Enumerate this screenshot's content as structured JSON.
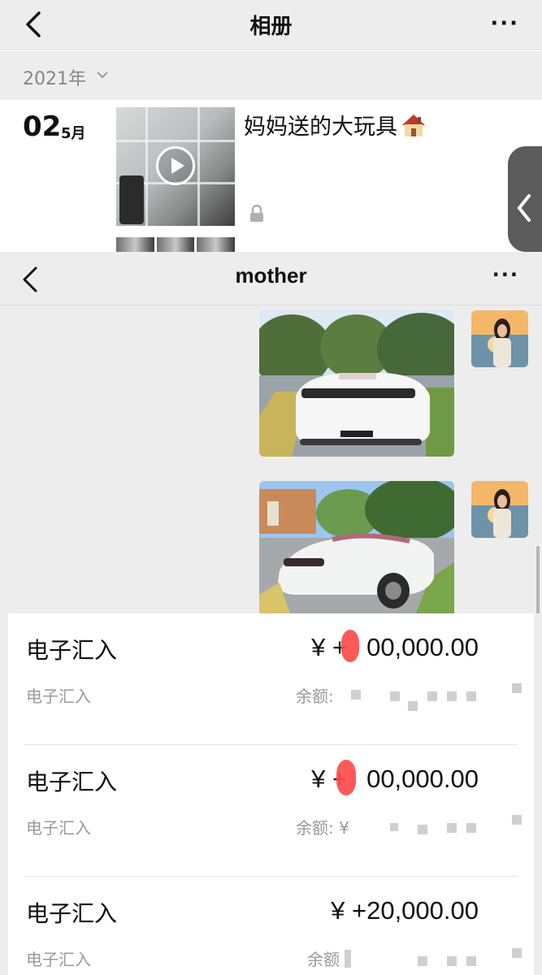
{
  "album": {
    "title": "相册",
    "more": "···",
    "year": "2021年",
    "post": {
      "day": "02",
      "month": "5月",
      "caption": "妈妈送的大玩具"
    }
  },
  "chat": {
    "title": "mother",
    "more": "···"
  },
  "transactions": [
    {
      "type": "电子汇入",
      "sub": "电子汇入",
      "amount": "¥ +",
      "amount_tail": "00,000.00",
      "balance_label": "余额:"
    },
    {
      "type": "电子汇入",
      "sub": "电子汇入",
      "amount": "¥ +",
      "amount_tail": "00,000.00",
      "balance_label": "余额: ¥"
    },
    {
      "type": "电子汇入",
      "sub": "电子汇入",
      "amount": "¥ +20,000.00",
      "amount_tail": "",
      "balance_label": "余额"
    }
  ],
  "colors": {
    "redaction": "#ff4b4b",
    "page_bg": "#ededed",
    "secondary_text": "#9a9a9a"
  }
}
